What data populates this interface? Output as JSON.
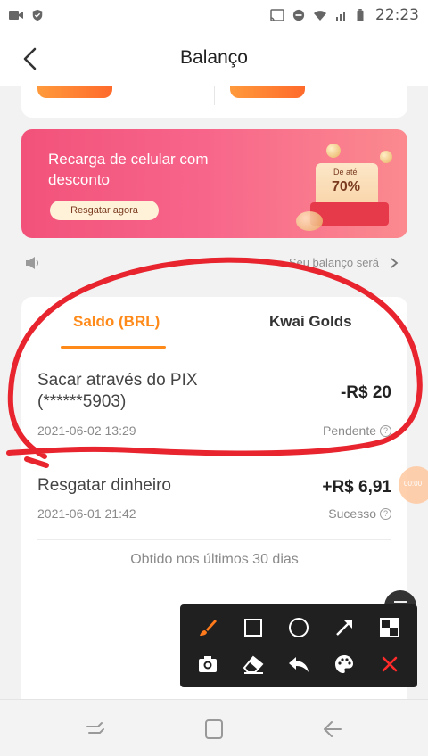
{
  "status_bar": {
    "time": "22:23"
  },
  "header": {
    "title": "Balanço"
  },
  "promo": {
    "title": "Recarga de celular com desconto",
    "button_label": "Resgatar agora",
    "badge_small": "De até",
    "badge_big": "70%"
  },
  "notice": {
    "text": "Seu balanço será"
  },
  "tabs": [
    {
      "label": "Saldo (BRL)"
    },
    {
      "label": "Kwai Golds"
    }
  ],
  "transactions": [
    {
      "title": "Sacar através do PIX (******5903)",
      "amount": "-R$ 20",
      "date": "2021-06-02 13:29",
      "status": "Pendente"
    },
    {
      "title": "Resgatar dinheiro",
      "amount": "+R$ 6,91",
      "date": "2021-06-01 21:42",
      "status": "Sucesso"
    }
  ],
  "footer_note": "Obtido nos últimos 30 dias",
  "float_bubble_text": "00:00",
  "colors": {
    "accent": "#ff8a1a",
    "annotation": "#e8242e",
    "promo_start": "#f2527a",
    "promo_end": "#fb8a8f"
  },
  "toolbar_icons": [
    "brush-icon",
    "square-icon",
    "circle-icon",
    "arrow-icon",
    "mosaic-icon",
    "camera-icon",
    "eraser-icon",
    "undo-icon",
    "palette-icon",
    "close-icon"
  ]
}
